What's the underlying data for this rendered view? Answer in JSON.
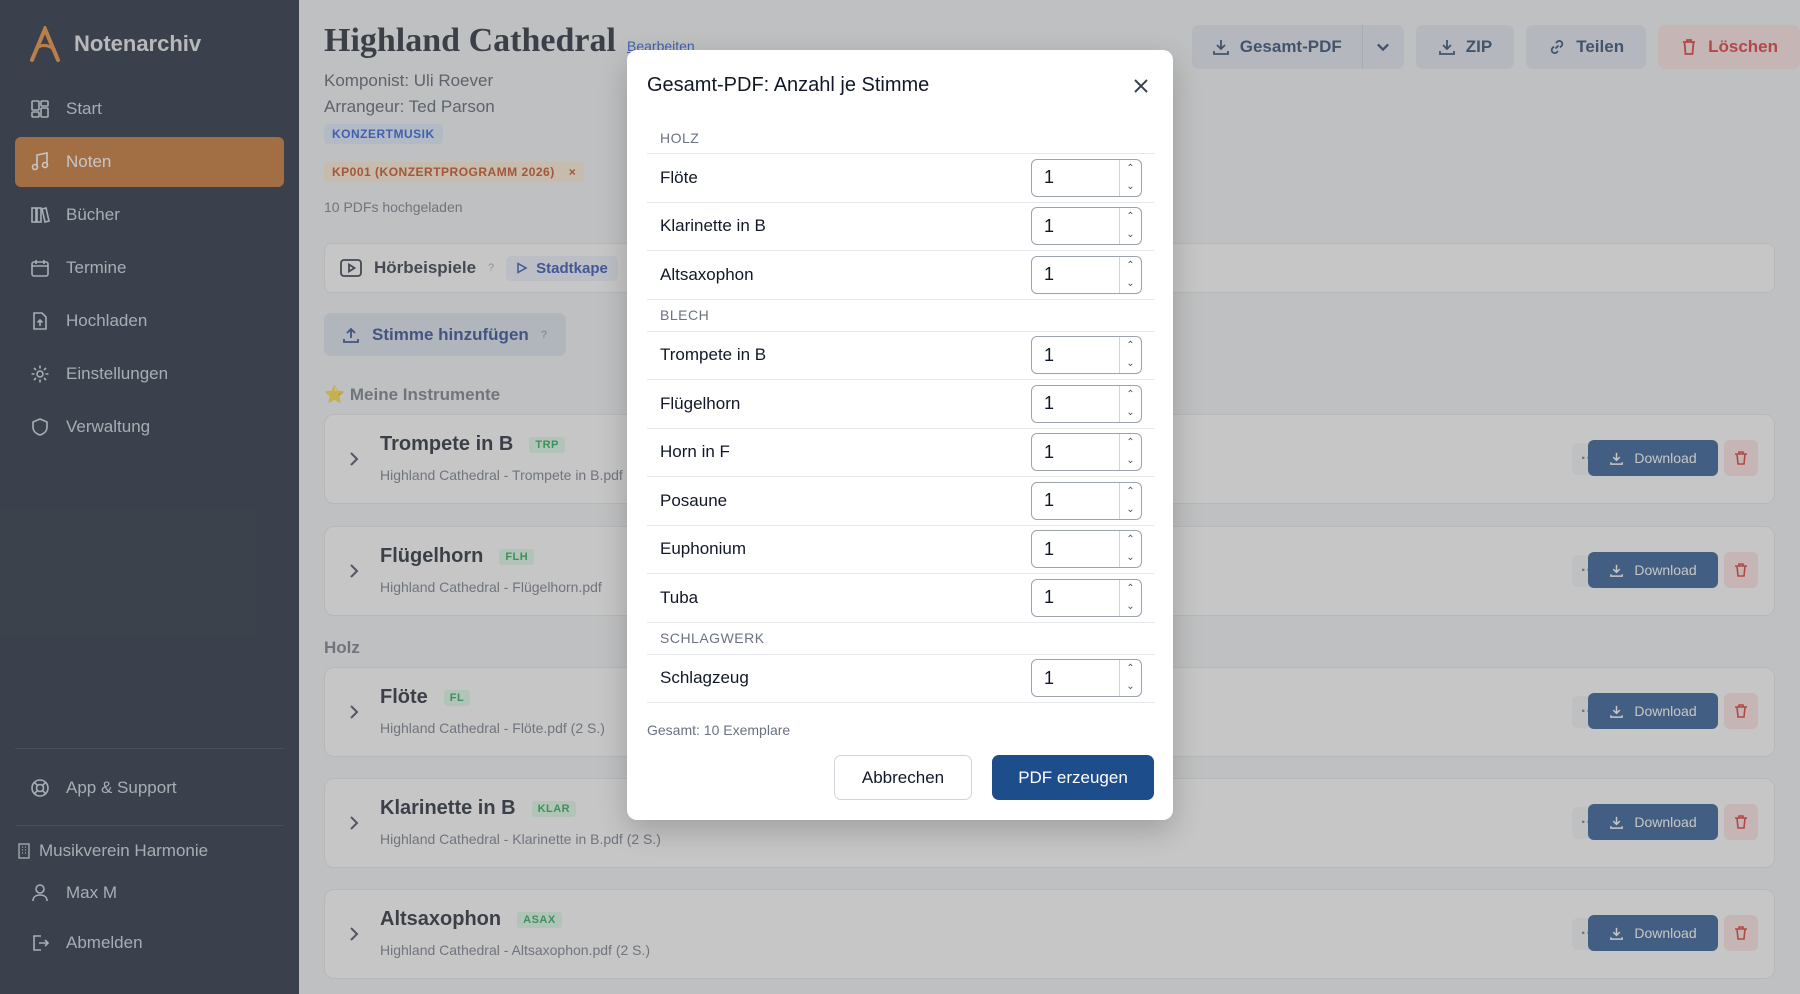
{
  "app": {
    "name": "Notenarchiv"
  },
  "colors": {
    "sidebar_bg": "#0f1b2d",
    "accent": "#c2691f",
    "primary": "#1e4d8c",
    "danger": "#dc2626"
  },
  "nav": [
    {
      "label": "Start",
      "icon": "dashboard-icon",
      "active": false
    },
    {
      "label": "Noten",
      "icon": "music-note-icon",
      "active": true
    },
    {
      "label": "Bücher",
      "icon": "books-icon",
      "active": false
    },
    {
      "label": "Termine",
      "icon": "calendar-icon",
      "active": false
    },
    {
      "label": "Hochladen",
      "icon": "upload-file-icon",
      "active": false
    },
    {
      "label": "Einstellungen",
      "icon": "gear-icon",
      "active": false
    },
    {
      "label": "Verwaltung",
      "icon": "shield-icon",
      "active": false
    }
  ],
  "sidebar_bottom": {
    "support": "App & Support",
    "org": "Musikverein Harmonie",
    "user": "Max M",
    "logout": "Abmelden"
  },
  "piece": {
    "title": "Highland Cathedral",
    "edit": "Bearbeiten",
    "composer": "Komponist: Uli Roever",
    "arranger": "Arrangeur: Ted Parson",
    "category": "KONZERTMUSIK",
    "program": "KP001 (KONZERTPROGRAMM 2026)",
    "program_remove": "×",
    "uploaded": "10 PDFs hochgeladen"
  },
  "actions": {
    "pdf": "Gesamt-PDF",
    "zip": "ZIP",
    "share": "Teilen",
    "delete": "Löschen"
  },
  "audio": {
    "label": "Hörbeispiele",
    "help": "?",
    "chip": "Stadtkape"
  },
  "add_voice": {
    "label": "Stimme hinzufügen",
    "help": "?"
  },
  "sections": {
    "mine": "⭐ Meine Instrumente",
    "holz": "Holz"
  },
  "voices": [
    {
      "name": "Trompete in B",
      "tag": "TRP",
      "file": "Highland Cathedral - Trompete in B.pdf"
    },
    {
      "name": "Flügelhorn",
      "tag": "FLH",
      "file": "Highland Cathedral - Flügelhorn.pdf"
    },
    {
      "name": "Flöte",
      "tag": "FL",
      "file": "Highland Cathedral - Flöte.pdf (2 S.)"
    },
    {
      "name": "Klarinette in B",
      "tag": "KLAR",
      "file": "Highland Cathedral - Klarinette in B.pdf (2 S.)"
    },
    {
      "name": "Altsaxophon",
      "tag": "ASAX",
      "file": "Highland Cathedral - Altsaxophon.pdf (2 S.)"
    }
  ],
  "voice_download": "Download",
  "voice_more": "···",
  "modal": {
    "title": "Gesamt-PDF: Anzahl je Stimme",
    "groups": [
      {
        "name": "HOLZ",
        "items": [
          {
            "label": "Flöte",
            "count": "1"
          },
          {
            "label": "Klarinette in B",
            "count": "1"
          },
          {
            "label": "Altsaxophon",
            "count": "1"
          }
        ]
      },
      {
        "name": "BLECH",
        "items": [
          {
            "label": "Trompete in B",
            "count": "1"
          },
          {
            "label": "Flügelhorn",
            "count": "1"
          },
          {
            "label": "Horn in F",
            "count": "1"
          },
          {
            "label": "Posaune",
            "count": "1"
          },
          {
            "label": "Euphonium",
            "count": "1"
          },
          {
            "label": "Tuba",
            "count": "1"
          }
        ]
      },
      {
        "name": "SCHLAGWERK",
        "items": [
          {
            "label": "Schlagzeug",
            "count": "1"
          }
        ]
      }
    ],
    "total": "Gesamt: 10 Exemplare",
    "cancel": "Abbrechen",
    "confirm": "PDF erzeugen"
  }
}
